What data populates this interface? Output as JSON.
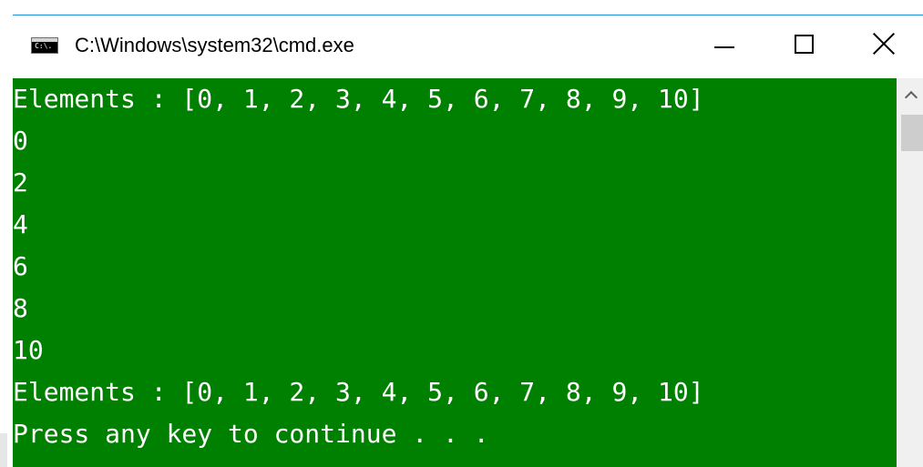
{
  "window": {
    "title": "C:\\Windows\\system32\\cmd.exe",
    "icon": "cmd-icon",
    "icon_text": "C:\\."
  },
  "caption_buttons": {
    "minimize": "minimize-icon",
    "maximize": "maximize-icon",
    "close": "close-icon"
  },
  "console": {
    "background": "#008000",
    "foreground": "#ffffff",
    "lines": [
      "Elements : [0, 1, 2, 3, 4, 5, 6, 7, 8, 9, 10]",
      "0",
      "2",
      "4",
      "6",
      "8",
      "10",
      "Elements : [0, 1, 2, 3, 4, 5, 6, 7, 8, 9, 10]",
      "Press any key to continue . . ."
    ]
  },
  "scrollbar": {
    "up_arrow": "chevron-up-icon"
  }
}
